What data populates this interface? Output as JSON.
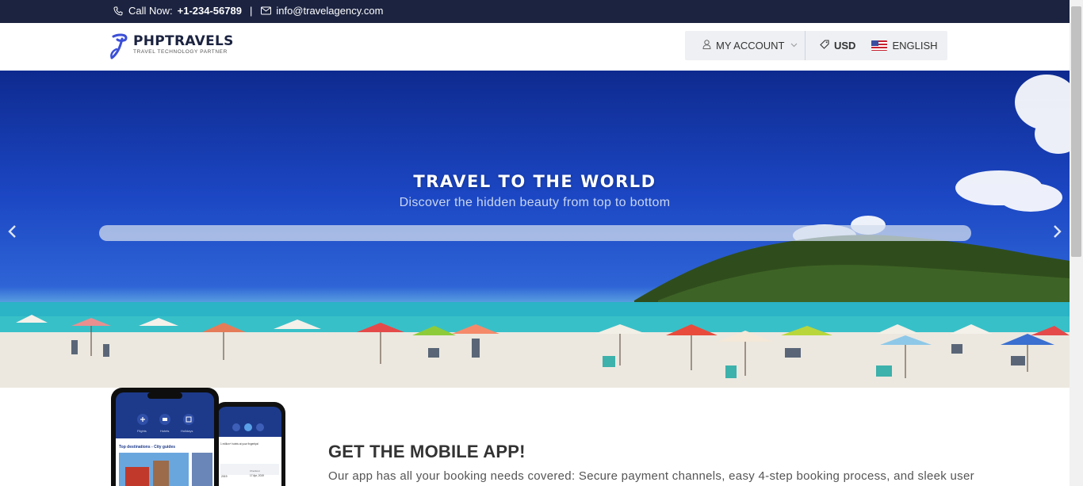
{
  "topbar": {
    "call_label": "Call Now:",
    "phone": "+1-234-56789",
    "separator": "|",
    "email": "info@travelagency.com",
    "icons": [
      "phone-icon",
      "envelope-icon"
    ]
  },
  "header": {
    "brand": "PHPTRAVELS",
    "tagline": "TRAVEL TECHNOLOGY PARTNER",
    "account_label": "MY ACCOUNT",
    "currency": "USD",
    "language": "ENGLISH"
  },
  "hero": {
    "title": "TRAVEL TO THE WORLD",
    "subtitle": "Discover the hidden beauty from top to bottom",
    "search_placeholder": "",
    "prev_arrow": "‹",
    "next_arrow": "›"
  },
  "app": {
    "title": "GET THE MOBILE APP!",
    "description": "Our app has all your booking needs covered: Secure payment channels, easy 4-step booking process, and sleek user",
    "phone_screen": {
      "tabs": [
        "Flights",
        "Hotels",
        "Holidays"
      ],
      "destinations_heading": "Top destinations - City guides",
      "second_screen_text": "1 million+ hotels at your fingertips!",
      "dates": [
        "2019",
        "Checkout",
        "17 Apr, 2019",
        "2019"
      ]
    }
  },
  "colors": {
    "topbar_bg": "#1b2340",
    "account_box_bg": "#eef0f3",
    "brand_blue": "#3b4fd8"
  }
}
